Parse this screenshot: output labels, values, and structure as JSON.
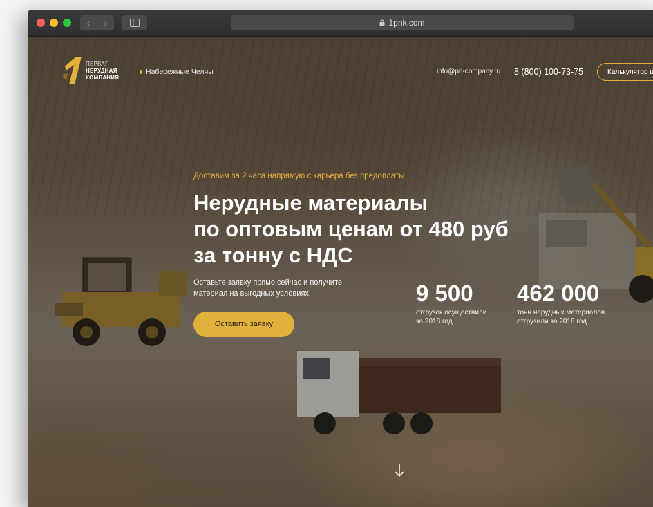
{
  "browser": {
    "url": "1pnk.com"
  },
  "header": {
    "logo_lines": [
      "ПЕРВАЯ",
      "НЕРУДНАЯ",
      "КОМПАНИЯ"
    ],
    "city": "Набережные Челны",
    "email": "info@pn-company.ru",
    "phone": "8 (800) 100-73-75",
    "calculator_label": "Калькулятор ц"
  },
  "hero": {
    "tagline": "Доставим за 2 часа напрямую с карьера без предоплаты",
    "headline_lines": [
      "Нерудные материалы",
      "по оптовым ценам от 480 руб",
      "за тонну с НДС"
    ],
    "subtext_lines": [
      "Оставьте заявку прямо сейчас и получите",
      "материал на выгодных условиях:"
    ],
    "cta_label": "Оставить заявку"
  },
  "stats": [
    {
      "value": "9 500",
      "caption_lines": [
        "отгрузок осуществили",
        "за 2018 год"
      ]
    },
    {
      "value": "462 000",
      "caption_lines": [
        "тонн нерудных материалов",
        "отгрузили за 2018 год"
      ]
    }
  ],
  "colors": {
    "accent": "#e2b13b",
    "text": "#ffffff"
  },
  "icons": {
    "scroll": "arrow-down-icon",
    "lock": "lock-icon",
    "city": "location-pin-icon"
  }
}
